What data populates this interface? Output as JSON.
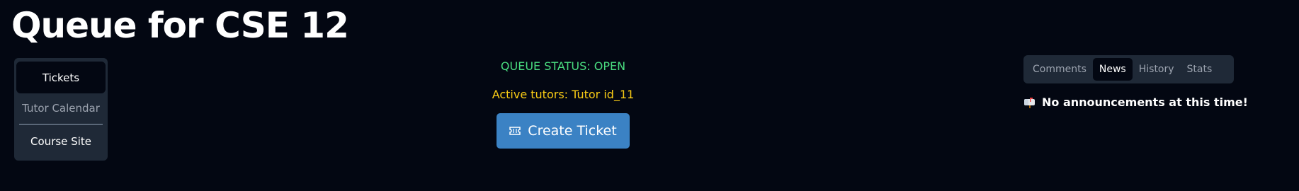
{
  "header": {
    "title": "Queue for CSE 12"
  },
  "sidebar": {
    "items": [
      {
        "label": "Tickets"
      },
      {
        "label": "Tutor Calendar"
      },
      {
        "label": "Course Site"
      }
    ]
  },
  "queue": {
    "status": "QUEUE STATUS: OPEN",
    "active_tutors": "Active tutors: Tutor id_11",
    "create_button_label": "Create Ticket",
    "create_button_icon": "ticket-icon"
  },
  "news_panel": {
    "tabs": [
      {
        "label": "Comments"
      },
      {
        "label": "News"
      },
      {
        "label": "History"
      },
      {
        "label": "Stats"
      }
    ],
    "selected_tab": "News",
    "announcement_icon": "mailbox-icon",
    "announcement_text": "No announcements at this time!"
  },
  "colors": {
    "background": "#030712",
    "status_open": "#4ade80",
    "tutors": "#facc15",
    "primary_button": "#3b82c4",
    "panel": "#1f2937"
  }
}
